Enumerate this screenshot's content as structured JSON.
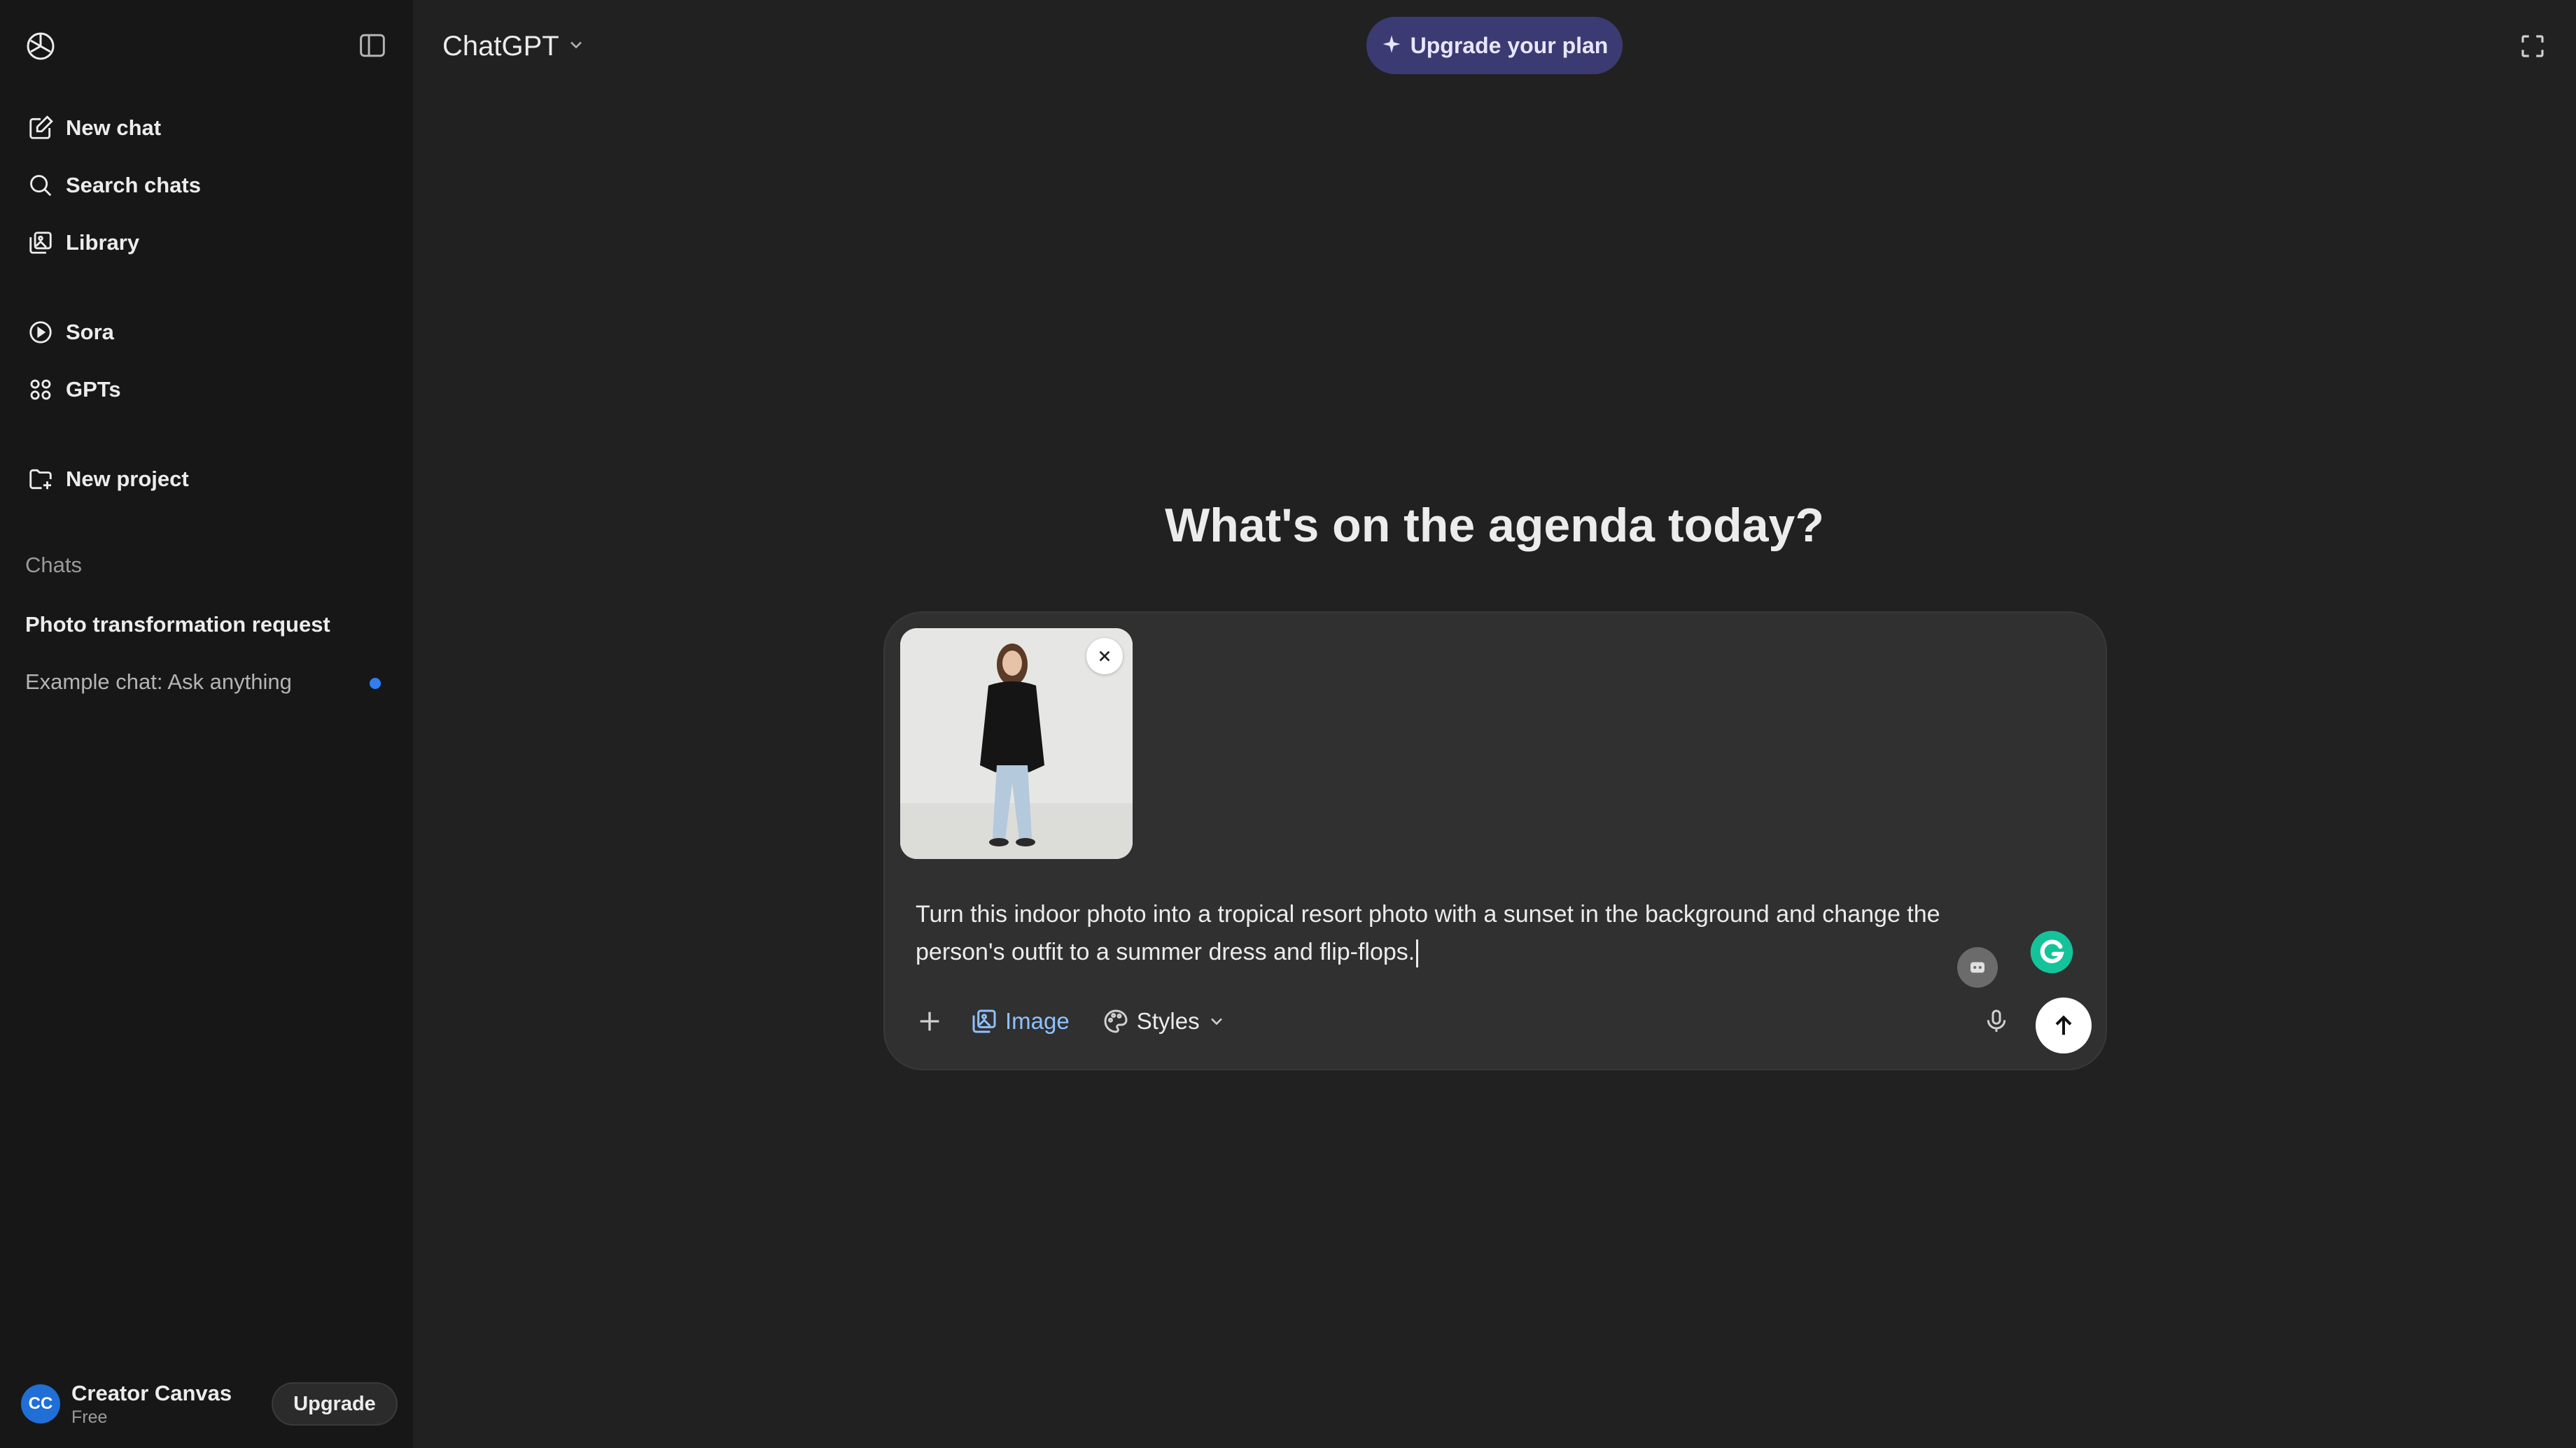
{
  "app": {
    "model_label": "ChatGPT"
  },
  "sidebar": {
    "items": [
      {
        "label": "New chat",
        "icon": "new-chat-icon"
      },
      {
        "label": "Search chats",
        "icon": "search-icon"
      },
      {
        "label": "Library",
        "icon": "library-icon"
      },
      {
        "label": "Sora",
        "icon": "play-icon"
      },
      {
        "label": "GPTs",
        "icon": "grid-icon"
      },
      {
        "label": "New project",
        "icon": "folder-plus-icon"
      }
    ],
    "section_label": "Chats",
    "chats": [
      {
        "label": "Photo transformation request",
        "active": true
      },
      {
        "label": "Example chat: Ask anything",
        "unread": true
      }
    ],
    "user": {
      "initials": "CC",
      "name": "Creator Canvas",
      "plan": "Free",
      "upgrade_label": "Upgrade"
    }
  },
  "header": {
    "upgrade_plan_label": "Upgrade your plan"
  },
  "main": {
    "headline": "What's on the agenda today?",
    "composer": {
      "prompt": "Turn this indoor photo into a tropical resort photo with a sunset in the background and change the person's outfit to a summer dress and flip-flops.",
      "toolbar": {
        "image_label": "Image",
        "styles_label": "Styles"
      }
    }
  },
  "colors": {
    "background": "#212121",
    "sidebar": "#171717",
    "composer": "#303030",
    "upgrade_plan_bg": "#3c3a72",
    "accent_blue": "#8fc1ff",
    "unread_dot": "#2f7ff0",
    "grammarly": "#15c39a"
  }
}
